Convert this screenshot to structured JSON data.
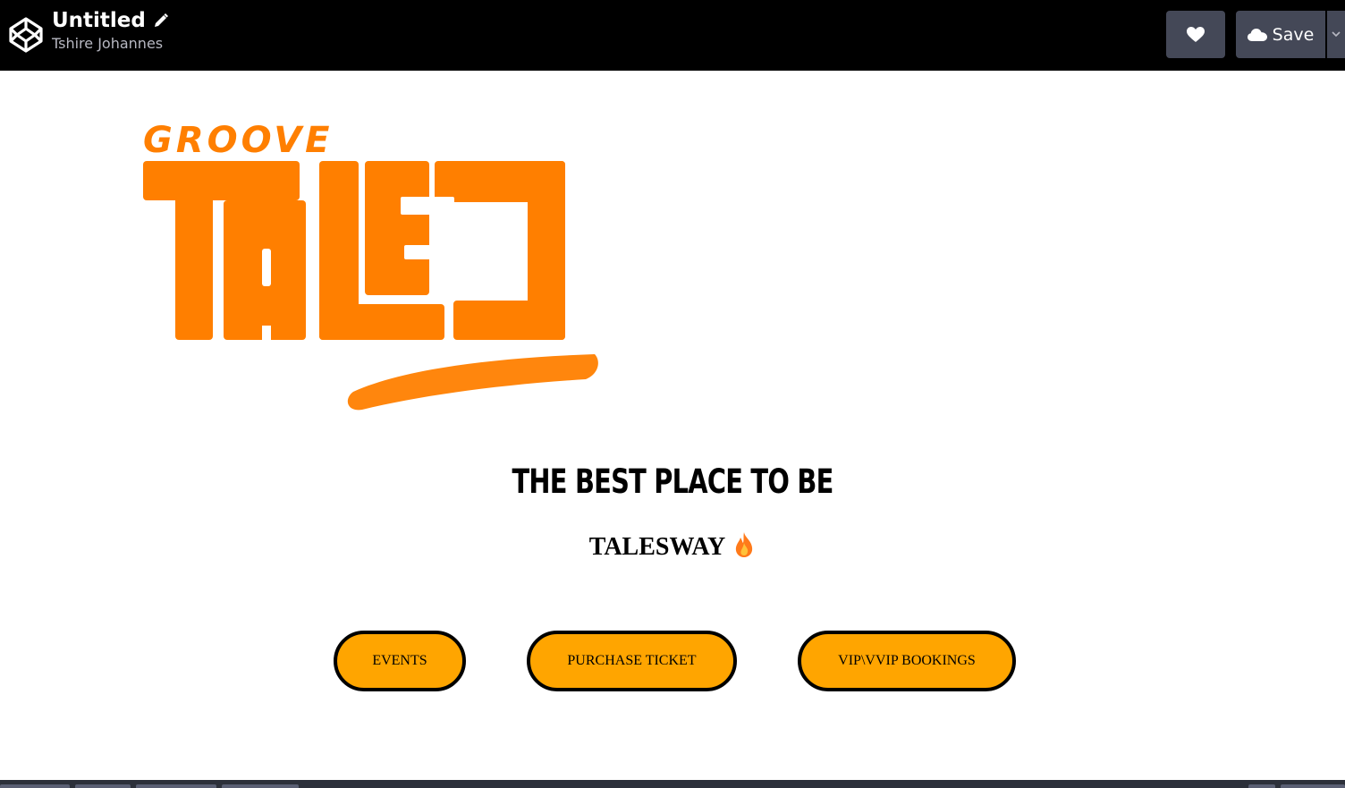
{
  "header": {
    "app_logo_icon": "codepen-logo-icon",
    "title": "Untitled",
    "edit_icon": "pencil-icon",
    "author": "Tshire Johannes",
    "like_icon": "heart-icon",
    "save_icon": "cloud-icon",
    "save_label": "Save",
    "dropdown_icon": "chevron-down-icon"
  },
  "preview": {
    "logo": {
      "small_text": "GROOVE",
      "big_text": "TALES",
      "color": "#ff7f00"
    },
    "tagline": "THE BEST PLACE TO BE",
    "subheading": "TALESWAY",
    "subheading_icon": "fire-icon",
    "buttons": [
      {
        "label": "EVENTS"
      },
      {
        "label": "PURCHASE TICKET"
      },
      {
        "label": "VIP\\VVIP BOOKINGS"
      }
    ]
  },
  "colors": {
    "topbar_bg": "#000000",
    "button_bg": "#444857",
    "accent_orange": "#ff7f00",
    "cta_fill": "#ffa500"
  }
}
